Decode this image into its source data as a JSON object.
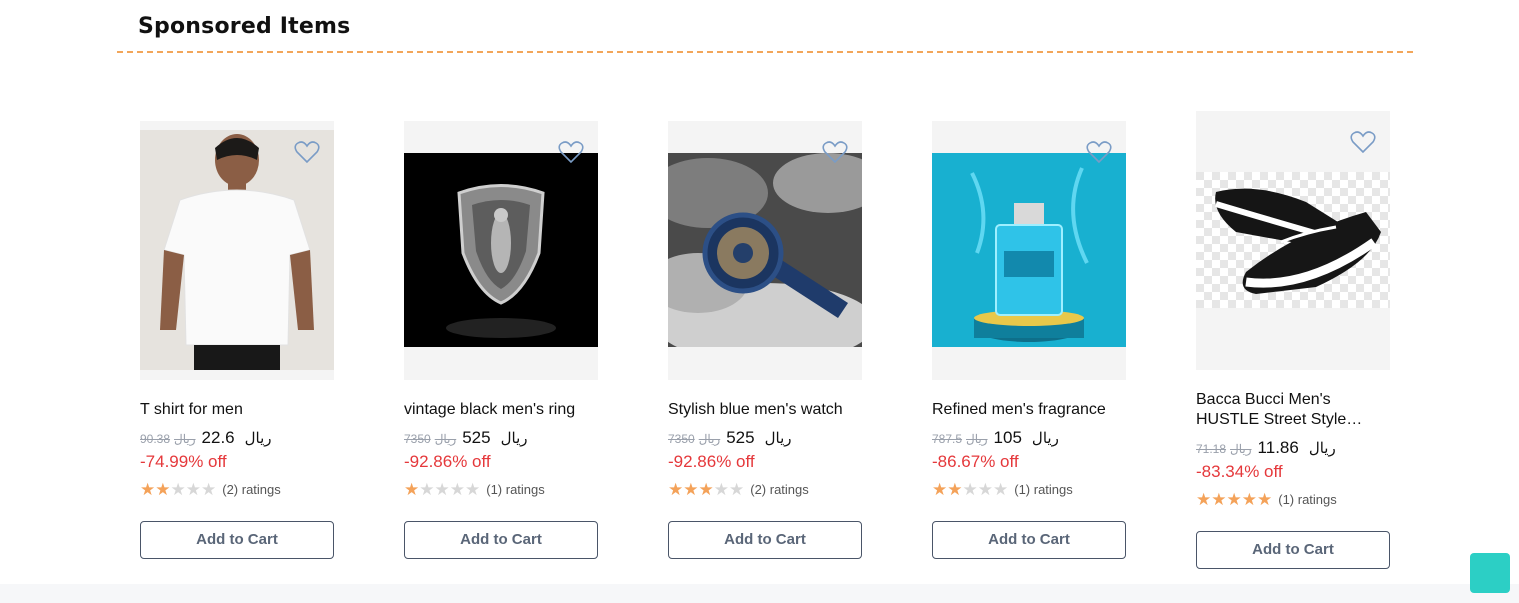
{
  "section": {
    "title": "Sponsored Items"
  },
  "colors": {
    "accent_dash": "#f2a65a",
    "discount": "#e5383b",
    "star_on": "#f4a259",
    "star_off": "#d7d7d7",
    "fab": "#2ccfc5"
  },
  "products": [
    {
      "name": "T shirt for men",
      "old_price": "90.38",
      "currency": "ريال",
      "price": "22.6",
      "discount": "-74.99% off",
      "rating": 2,
      "ratings_text": "(2) ratings",
      "button": "Add to Cart",
      "image_icon": "tshirt-photo"
    },
    {
      "name": "vintage black men's ring",
      "old_price": "7350",
      "currency": "ريال",
      "price": "525",
      "discount": "-92.86% off",
      "rating": 1,
      "ratings_text": "(1) ratings",
      "button": "Add to Cart",
      "image_icon": "ring-photo"
    },
    {
      "name": "Stylish blue men's watch",
      "old_price": "7350",
      "currency": "ريال",
      "price": "525",
      "discount": "-92.86% off",
      "rating": 3,
      "ratings_text": "(2) ratings",
      "button": "Add to Cart",
      "image_icon": "watch-photo"
    },
    {
      "name": "Refined men's fragrance",
      "old_price": "787.5",
      "currency": "ريال",
      "price": "105",
      "discount": "-86.67% off",
      "rating": 2,
      "ratings_text": "(1) ratings",
      "button": "Add to Cart",
      "image_icon": "fragrance-photo"
    },
    {
      "name": "Bacca Bucci Men's HUSTLE Street Style…",
      "old_price": "71.18",
      "currency": "ريال",
      "price": "11.86",
      "discount": "-83.34% off",
      "rating": 5,
      "ratings_text": "(1) ratings",
      "button": "Add to Cart",
      "image_icon": "sneaker-photo"
    }
  ]
}
